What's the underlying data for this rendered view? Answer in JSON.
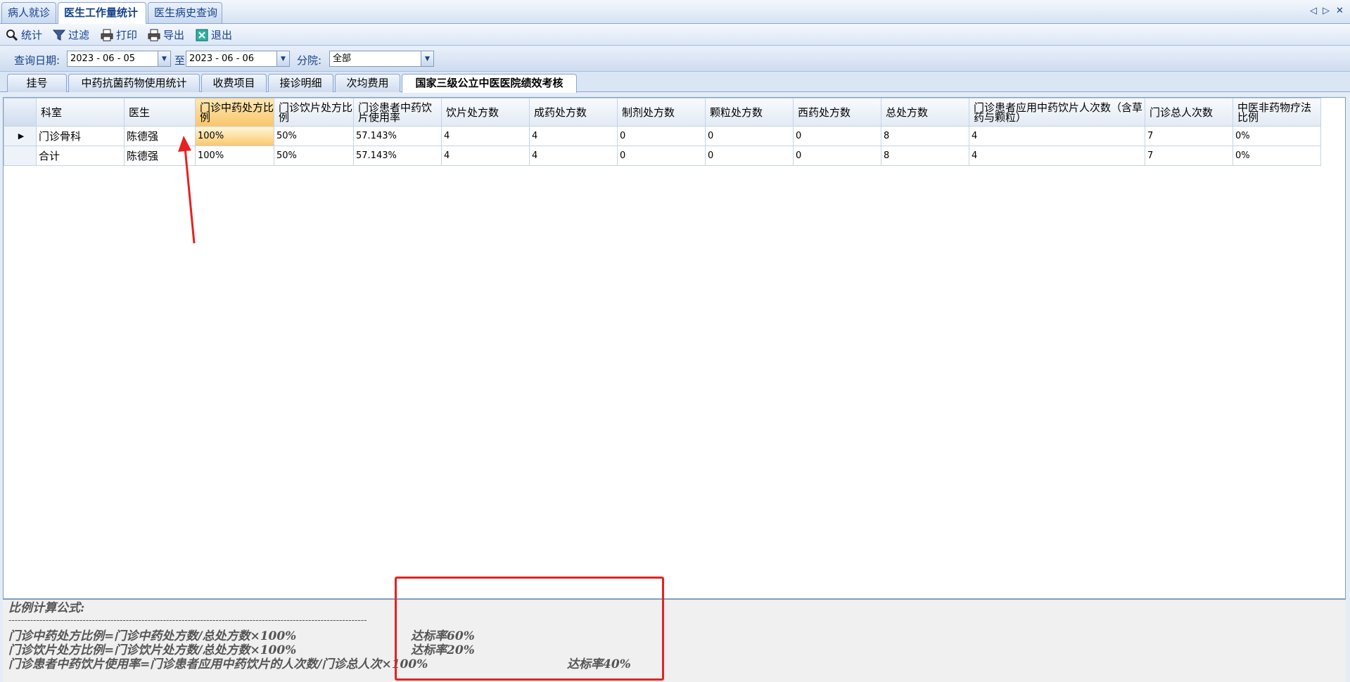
{
  "doc_tabs": [
    {
      "label": "病人就诊",
      "active": false
    },
    {
      "label": "医生工作量统计",
      "active": true
    },
    {
      "label": "医生病史查询",
      "active": false
    }
  ],
  "tab_nav": {
    "prev": "◁",
    "next": "▷",
    "close": "✕"
  },
  "toolbar": {
    "stats": "统计",
    "filter": "过滤",
    "print": "打印",
    "export": "导出",
    "exit": "退出"
  },
  "query": {
    "date_label": "查询日期:",
    "date_from": "2023 - 06 - 05",
    "to_label": "至",
    "date_to": "2023 - 06 - 06",
    "branch_label": "分院:",
    "branch_value": "全部"
  },
  "page_tabs": [
    {
      "label": "挂号",
      "active": false
    },
    {
      "label": "中药抗菌药物使用统计",
      "active": false
    },
    {
      "label": "收费项目",
      "active": false
    },
    {
      "label": "接诊明细",
      "active": false
    },
    {
      "label": "次均费用",
      "active": false
    },
    {
      "label": "国家三级公立中医医院绩效考核",
      "active": true
    }
  ],
  "grid": {
    "columns": [
      "科室",
      "医生",
      "门诊中药处方比例",
      "门诊饮片处方比例",
      "门诊患者中药饮片使用率",
      "饮片处方数",
      "成药处方数",
      "制剂处方数",
      "颗粒处方数",
      "西药处方数",
      "总处方数",
      "门诊患者应用中药饮片人次数（含草药与颗粒）",
      "门诊总人次数",
      "中医非药物疗法比例"
    ],
    "rows": [
      {
        "indicator": "▶",
        "cells": [
          "门诊骨科",
          "陈德强",
          "100%",
          "50%",
          "57.143%",
          "4",
          "4",
          "0",
          "0",
          "0",
          "8",
          "4",
          "7",
          "0%"
        ]
      },
      {
        "indicator": "",
        "cells": [
          "合计",
          "陈德强",
          "100%",
          "50%",
          "57.143%",
          "4",
          "4",
          "0",
          "0",
          "0",
          "8",
          "4",
          "7",
          "0%"
        ]
      }
    ]
  },
  "formula": {
    "title": "比例计算公式:",
    "separator": "--------------------------------------------------------------------------------------------------------------------",
    "line1": "门诊中药处方比例=门诊中药处方数/总处方数×100%",
    "rate1": "达标率60%",
    "line2": "门诊饮片处方比例=门诊饮片处方数/总处方数×100%",
    "rate2": "达标率20%",
    "line3": "门诊患者中药饮片使用率=门诊患者应用中药饮片的人次数/门诊总人次×100%",
    "rate3": "达标率40%"
  },
  "colors": {
    "annotation": "#e52222",
    "tab_text": "#15428b",
    "selected_header": "#f8c66b"
  }
}
